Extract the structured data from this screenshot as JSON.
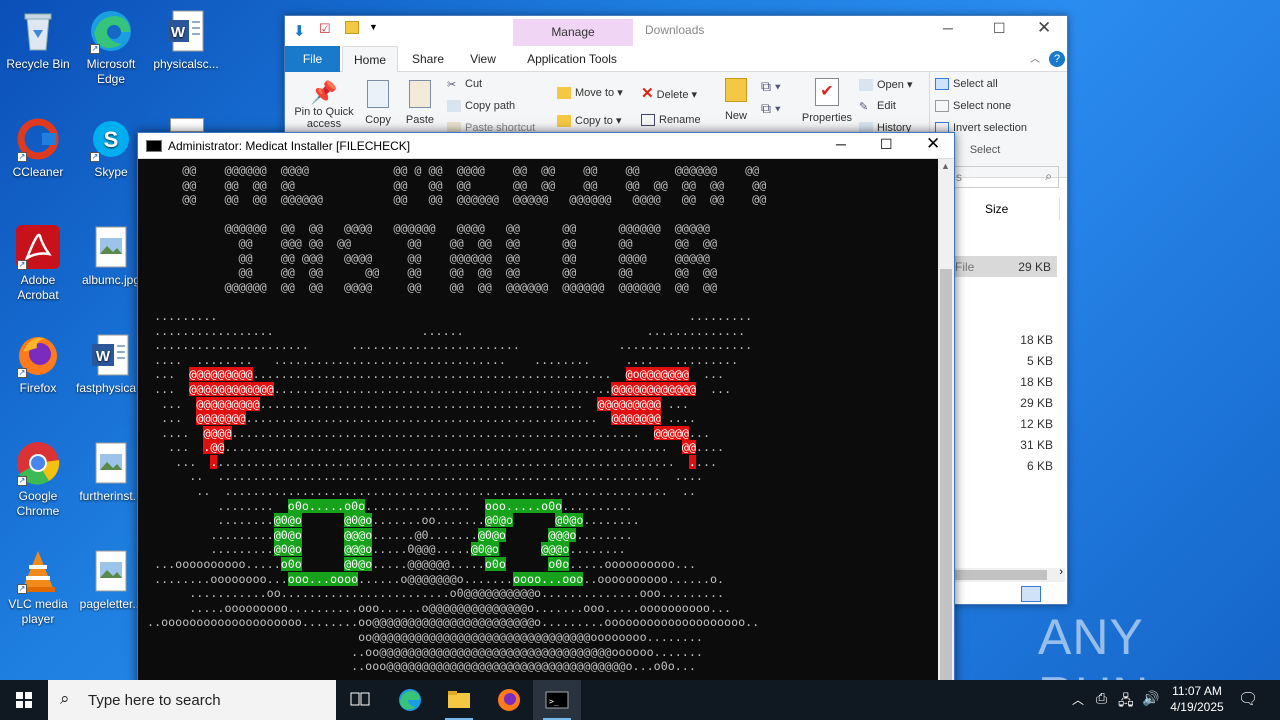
{
  "desktop": {
    "icons_col1": [
      {
        "label": "Recycle Bin",
        "icon": "recycle-bin-icon"
      },
      {
        "label": "CCleaner",
        "icon": "ccleaner-icon"
      },
      {
        "label": "Adobe Acrobat",
        "icon": "adobe-acrobat-icon"
      },
      {
        "label": "Firefox",
        "icon": "firefox-icon"
      },
      {
        "label": "Google Chrome",
        "icon": "chrome-icon"
      },
      {
        "label": "VLC media player",
        "icon": "vlc-icon"
      }
    ],
    "icons_col2": [
      {
        "label": "Microsoft Edge",
        "icon": "edge-icon"
      },
      {
        "label": "Skype",
        "icon": "skype-icon"
      },
      {
        "label": "albumc.jpg",
        "icon": "image-file-icon"
      },
      {
        "label": "fastphysica...",
        "icon": "word-doc-icon"
      },
      {
        "label": "furtherinst...",
        "icon": "image-file-icon"
      },
      {
        "label": "pageletter...",
        "icon": "image-file-icon"
      }
    ],
    "icons_col3": [
      {
        "label": "physicalsc...",
        "icon": "word-doc-icon"
      }
    ],
    "watermark": "ANY RUN"
  },
  "explorer": {
    "title": "Downloads",
    "manage_label": "Manage",
    "tabs": [
      "File",
      "Home",
      "Share",
      "View",
      "Application Tools"
    ],
    "ribbon": {
      "pin_label": "Pin to Quick access",
      "copy_label": "Copy",
      "paste_label": "Paste",
      "cut_label": "Cut",
      "copy_path_label": "Copy path",
      "paste_shortcut_label": "Paste shortcut",
      "move_to_label": "Move to",
      "copy_to_label": "Copy to",
      "delete_label": "Delete",
      "rename_label": "Rename",
      "new_folder_label": "New folder",
      "properties_label": "Properties",
      "open_label": "Open",
      "edit_label": "Edit",
      "history_label": "History",
      "select_all_label": "Select all",
      "select_none_label": "Select none",
      "invert_selection_label": "Invert selection",
      "select_group_label": "Select"
    },
    "search_placeholder": "s",
    "size_header": "Size",
    "selected_row": {
      "type": "File",
      "size": "29 KB"
    },
    "sizes": [
      "18 KB",
      "5 KB",
      "18 KB",
      "29 KB",
      "12 KB",
      "31 KB",
      "6 KB"
    ]
  },
  "console": {
    "title": "Administrator:  Medicat Installer [FILECHECK]"
  },
  "taskbar": {
    "search_placeholder": "Type here to search",
    "time": "11:07 AM",
    "date": "4/19/2025"
  },
  "colors": {
    "console_red": "#e01010",
    "console_green": "#16a31b",
    "accent": "#1979ca"
  }
}
